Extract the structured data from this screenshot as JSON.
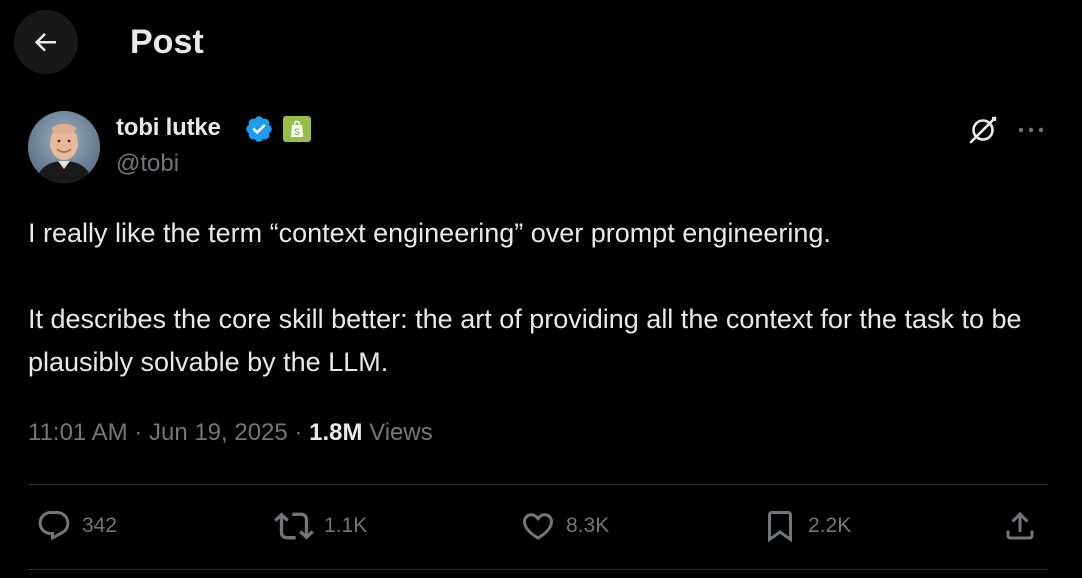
{
  "header": {
    "title": "Post",
    "back_icon": "arrow-left-icon"
  },
  "author": {
    "name": "tobi lutke",
    "handle": "@tobi",
    "verified_color": "#1d9bf0",
    "affiliate_color": "#95bf47",
    "affiliate_icon": "shopify-bag-icon"
  },
  "tweet": {
    "paragraphs": [
      "I really like the term “context engineering” over prompt engineering.",
      "It describes the core skill better: the art of providing all the context for the task to be plausibly solvable by the LLM."
    ]
  },
  "meta": {
    "time": "11:01 AM",
    "separator": "·",
    "date": "Jun 19, 2025",
    "views_count": "1.8M",
    "views_label": "Views"
  },
  "actions": {
    "replies": "342",
    "reposts": "1.1K",
    "likes": "8.3K",
    "bookmarks": "2.2K"
  },
  "colors": {
    "background": "#000000",
    "text_primary": "#e7e9ea",
    "text_secondary": "#71767b",
    "divider": "#2f3336"
  }
}
